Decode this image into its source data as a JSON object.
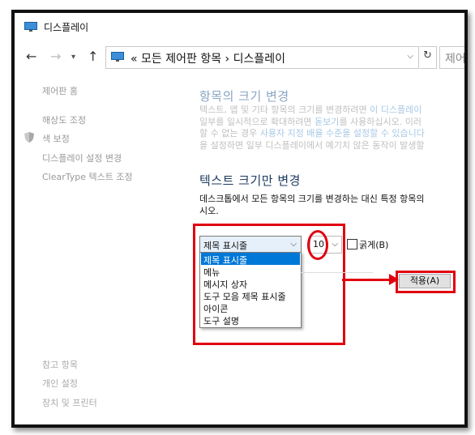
{
  "window": {
    "title": "디스플레이"
  },
  "address": {
    "prefix": "«",
    "path_1": "모든 제어판 항목",
    "separator": "›",
    "path_2": "디스플레이",
    "search_placeholder": "제어"
  },
  "left_nav": {
    "top_items": [
      "제어판 홈",
      "해상도 조정",
      "색 보정",
      "디스플레이 설정 변경",
      "ClearType 텍스트 조정"
    ],
    "see_also": [
      "참고 항목",
      "개인 설정",
      "장치 및 프린터"
    ]
  },
  "main": {
    "heading_all": "항목의 크기 변경",
    "para_lines": [
      [
        "텍스트, 앱 및 기타 항목의 크기를 변경하려면 ",
        "이 디스플레이"
      ],
      [
        "일부를 일시적으로 확대하려면 ",
        "돋보기",
        "를 사용하십시오. 이러"
      ],
      [
        "할 수 없는 경우 ",
        "사용자 지정 배율 수준을 설정할 수 있습니다"
      ],
      [
        "을 설정하면 일부 디스플레이에서 예기치 않은 동작이 발생할"
      ]
    ],
    "heading_text": "텍스트 크기만 변경",
    "desc_line1": "데스크톱에서 모든 항목의 크기를 변경하는 대신 특정 항목의",
    "desc_line2": "시오.",
    "combo_value": "제목 표시줄",
    "dropdown_options": [
      "제목 표시줄",
      "메뉴",
      "메시지 상자",
      "도구 모음 제목 표시줄",
      "아이콘",
      "도구 설명"
    ],
    "font_size": "10",
    "bold_label": "굵게(B)",
    "apply_label": "적용(A)"
  },
  "colors": {
    "annotation": "#e00010",
    "selection": "#0078d7"
  }
}
